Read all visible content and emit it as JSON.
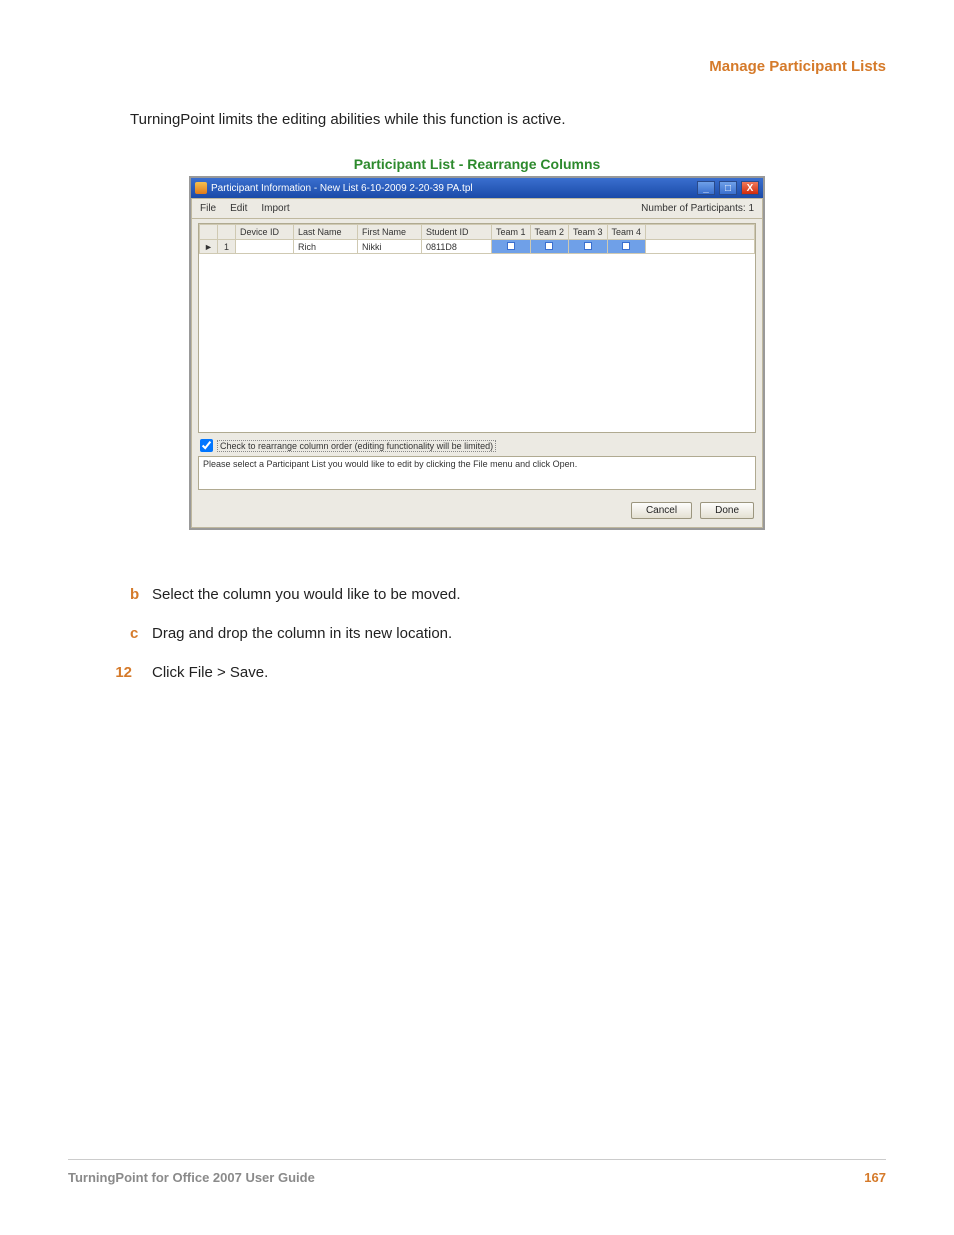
{
  "header": {
    "section_title": "Manage Participant Lists"
  },
  "intro_text": "TurningPoint limits the editing abilities while this function is active.",
  "figure_caption": "Participant List - Rearrange Columns",
  "window": {
    "title": "Participant Information - New List 6-10-2009 2-20-39 PA.tpl",
    "menus": {
      "file": "File",
      "edit": "Edit",
      "import": "Import"
    },
    "participants_label": "Number of Participants: 1",
    "columns": {
      "device_id": "Device ID",
      "last_name": "Last Name",
      "first_name": "First Name",
      "student_id": "Student ID",
      "team1": "Team 1",
      "team2": "Team 2",
      "team3": "Team 3",
      "team4": "Team 4"
    },
    "row1": {
      "indicator": "►",
      "num": "1",
      "device_id": "",
      "last_name": "Rich",
      "first_name": "Nikki",
      "student_id": "0811D8"
    },
    "checkbox_label": "Check to rearrange column order (editing functionality will be limited)",
    "status_text": "Please select a Participant List you would like to edit by clicking the File menu and click Open.",
    "buttons": {
      "cancel": "Cancel",
      "done": "Done"
    }
  },
  "steps": {
    "b": "Select the column you would like to be moved.",
    "c": "Drag and drop the column in its new location.",
    "n12": "12",
    "s12": "Click File > Save."
  },
  "footer": {
    "guide": "TurningPoint for Office 2007 User Guide",
    "page": "167"
  }
}
